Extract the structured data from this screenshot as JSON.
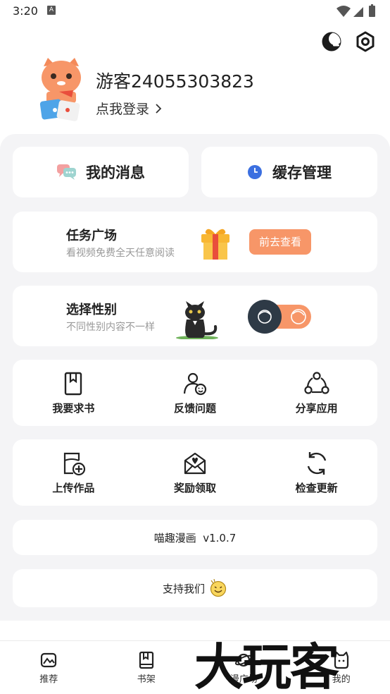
{
  "status_bar": {
    "time": "3:20",
    "notification_badge": "A"
  },
  "top_actions": {
    "night_mode_icon": "night-mode-icon",
    "settings_icon": "settings-hexagon-icon"
  },
  "profile": {
    "username": "游客24055303823",
    "login_prompt": "点我登录"
  },
  "quick_cards": {
    "messages_label": "我的消息",
    "cache_label": "缓存管理"
  },
  "task_card": {
    "title": "任务广场",
    "subtitle": "看视频免费全天任意阅读",
    "button_label": "前去查看"
  },
  "gender_card": {
    "title": "选择性别",
    "subtitle": "不同性别内容不一样"
  },
  "grid_row_1": [
    {
      "label": "我要求书",
      "icon": "book-request-icon"
    },
    {
      "label": "反馈问题",
      "icon": "feedback-icon"
    },
    {
      "label": "分享应用",
      "icon": "share-icon"
    }
  ],
  "grid_row_2": [
    {
      "label": "上传作品",
      "icon": "upload-icon"
    },
    {
      "label": "奖励领取",
      "icon": "reward-icon"
    },
    {
      "label": "检查更新",
      "icon": "refresh-icon"
    }
  ],
  "version": {
    "text": "喵趣漫画  v1.0.7"
  },
  "support": {
    "text": "支持我们"
  },
  "bottom_nav": [
    {
      "label": "推荐"
    },
    {
      "label": "书架"
    },
    {
      "label": "漫广场"
    },
    {
      "label": "我的"
    }
  ],
  "watermark": {
    "text": "大玩客"
  },
  "colors": {
    "accent": "#f79668",
    "panel_bg": "#f4f4f6",
    "dark_toggle": "#2e3a46",
    "clock_blue": "#3b6fe0"
  }
}
